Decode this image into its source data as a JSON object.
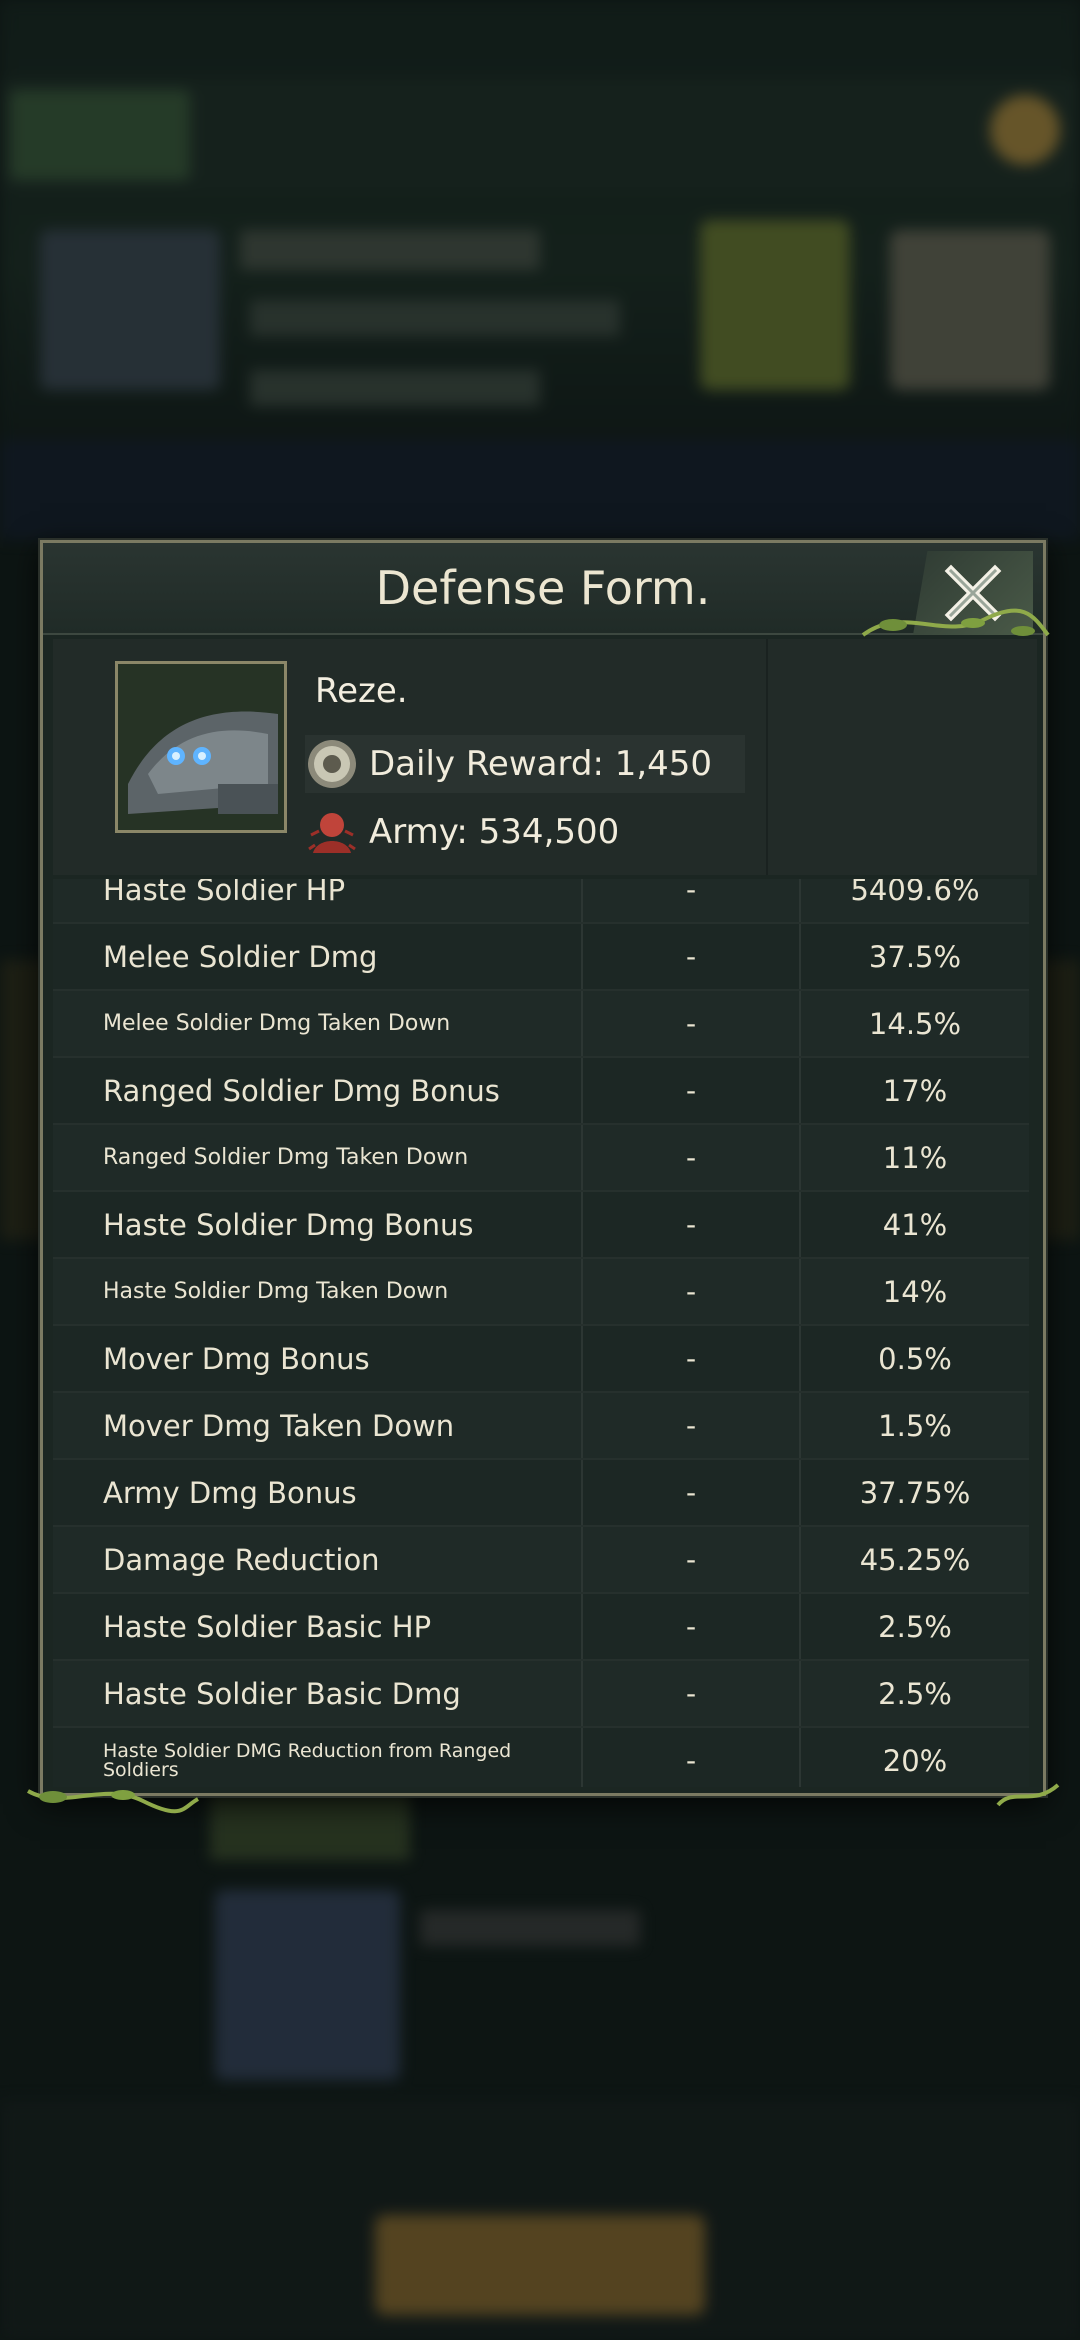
{
  "modal": {
    "title": "Defense Form.",
    "hero": {
      "name": "Reze.",
      "daily_reward": "Daily Reward: 1,450",
      "army": "Army: 534,500"
    },
    "stats": [
      {
        "name": "Haste Soldier HP",
        "base": "-",
        "value": "5409.6%",
        "size": "normal"
      },
      {
        "name": "Melee Soldier Dmg",
        "base": "-",
        "value": "37.5%",
        "size": "normal"
      },
      {
        "name": "Melee Soldier Dmg Taken Down",
        "base": "-",
        "value": "14.5%",
        "size": "small"
      },
      {
        "name": "Ranged Soldier Dmg Bonus",
        "base": "-",
        "value": "17%",
        "size": "normal"
      },
      {
        "name": "Ranged Soldier Dmg Taken Down",
        "base": "-",
        "value": "11%",
        "size": "small"
      },
      {
        "name": "Haste Soldier Dmg Bonus",
        "base": "-",
        "value": "41%",
        "size": "normal"
      },
      {
        "name": "Haste Soldier Dmg Taken Down",
        "base": "-",
        "value": "14%",
        "size": "small"
      },
      {
        "name": "Mover Dmg Bonus",
        "base": "-",
        "value": "0.5%",
        "size": "normal"
      },
      {
        "name": "Mover Dmg Taken Down",
        "base": "-",
        "value": "1.5%",
        "size": "normal"
      },
      {
        "name": "Army Dmg Bonus",
        "base": "-",
        "value": "37.75%",
        "size": "normal"
      },
      {
        "name": "Damage Reduction",
        "base": "-",
        "value": "45.25%",
        "size": "normal"
      },
      {
        "name": "Haste Soldier Basic HP",
        "base": "-",
        "value": "2.5%",
        "size": "normal"
      },
      {
        "name": "Haste Soldier Basic Dmg",
        "base": "-",
        "value": "2.5%",
        "size": "normal"
      },
      {
        "name": "Haste Soldier DMG Reduction from Ranged Soldiers",
        "base": "-",
        "value": "20%",
        "size": "tiny"
      }
    ]
  },
  "icons": {
    "close": "close-icon",
    "reward": "coin-icon",
    "army": "soldier-icon"
  }
}
